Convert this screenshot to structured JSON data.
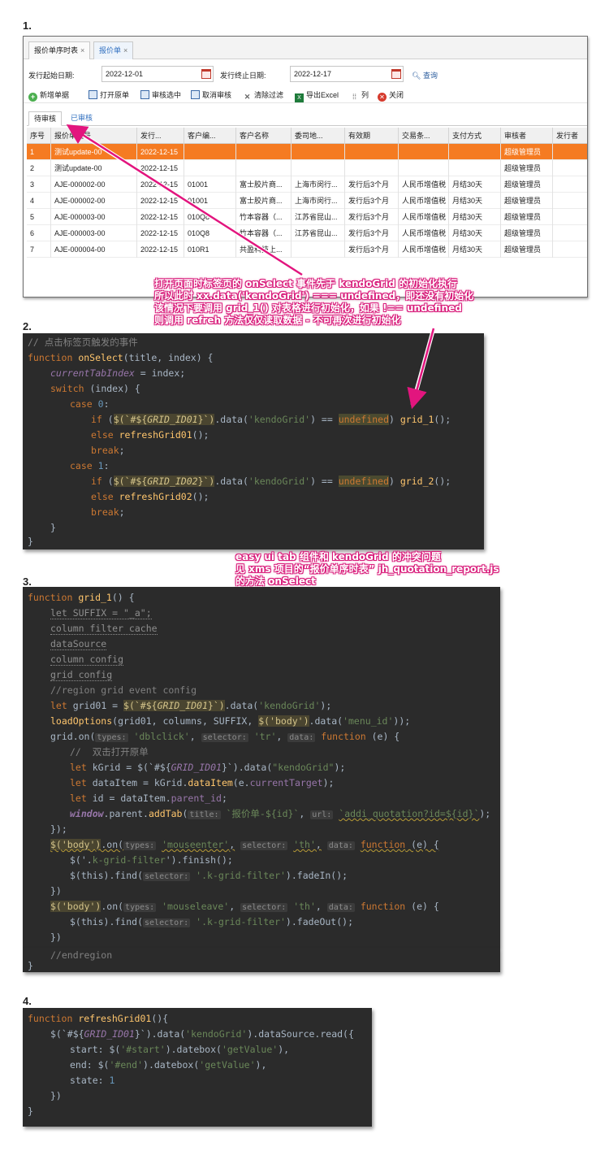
{
  "sections": {
    "s1": "1.",
    "s2": "2.",
    "s3": "3.",
    "s4": "4."
  },
  "app": {
    "tabs": [
      {
        "label": "报价单序时表",
        "close": "×"
      },
      {
        "label": "报价单",
        "close": "×"
      }
    ],
    "filter": {
      "start_label": "发行起始日期:",
      "start_value": "2022-12-01",
      "end_label": "发行终止日期:",
      "end_value": "2022-12-17",
      "query": "查询"
    },
    "toolbar": [
      "新增单据",
      "打开原单",
      "审核选中",
      "取消审核",
      "清除过滤",
      "导出Excel",
      "列",
      "关闭"
    ],
    "subtabs": [
      "待审核",
      "已审核"
    ],
    "grid": {
      "columns": [
        "序号",
        "报价单编号",
        "发行...",
        "客户编...",
        "客户名称",
        "委司地...",
        "有效期",
        "交易条...",
        "支付方式",
        "审核者",
        "发行者"
      ],
      "rows": [
        [
          "1",
          "测试update-00",
          "2022-12-15",
          "",
          "",
          "",
          "",
          "",
          "",
          "超级管理员",
          ""
        ],
        [
          "2",
          "测试update-00",
          "2022-12-15",
          "",
          "",
          "",
          "",
          "",
          "",
          "超级管理员",
          ""
        ],
        [
          "3",
          "AJE-000002-00",
          "2022-12-15",
          "01001",
          "富士胶片商...",
          "上海市闵行...",
          "发行后3个月",
          "人民币增值税",
          "月结30天",
          "超级管理员",
          ""
        ],
        [
          "4",
          "AJE-000002-00",
          "2022-12-15",
          "01001",
          "富士胶片商...",
          "上海市闵行...",
          "发行后3个月",
          "人民币增值税",
          "月结30天",
          "超级管理员",
          ""
        ],
        [
          "5",
          "AJE-000003-00",
          "2022-12-15",
          "010Q8",
          "竹本容器（...",
          "江苏省昆山...",
          "发行后3个月",
          "人民币增值税",
          "月结30天",
          "超级管理员",
          ""
        ],
        [
          "6",
          "AJE-000003-00",
          "2022-12-15",
          "010Q8",
          "竹本容器（...",
          "江苏省昆山...",
          "发行后3个月",
          "人民币增值税",
          "月结30天",
          "超级管理员",
          ""
        ],
        [
          "7",
          "AJE-000004-00",
          "2022-12-15",
          "010R1",
          "共盈科技上...",
          "",
          "发行后3个月",
          "人民币增值税",
          "月结30天",
          "超级管理员",
          ""
        ]
      ]
    }
  },
  "annotation1": [
    "打开页面时标签页的 onSelect 事件先于 kendoGrid 的初始化执行",
    "所以此时 xx.data('kendoGrid') === undefined，即还没有初始化",
    "该情况下要调用 grid_1() 对表格进行初始化，如果 !== undefined",
    "则调用 refreh 方法仅仅读取数据 - 不可再次进行初始化"
  ],
  "annotation2": [
    "easy ui tab 组件和 kendoGrid 的冲突问题",
    "见 xms 项目的“报价单序时表” jh_quotation_report.js",
    "的方法 onSelect"
  ],
  "code2": {
    "comment": "// 点击标签页触发的事件",
    "l1a": "function ",
    "l1b": "onSelect",
    "l1c": "(title, index) {",
    "l2a": "currentTabIndex",
    "l2b": " = index;",
    "l3a": "switch",
    "l3b": " (index) {",
    "case0a": "case ",
    "case0b": "0",
    "if": "if",
    "sel_open": "$(`#${",
    "grid1": "GRID_ID01",
    "grid2": "GRID_ID02",
    "sel_close": "}`)",
    "data": ".data(",
    "kg": "'kendoGrid'",
    "eq": ") == ",
    "undef": "undefined",
    "close_paren": ") ",
    "call1": "grid_1",
    "call2": "grid_2",
    "callend": "();",
    "else": "else ",
    "refresh1": "refreshGrid01",
    "refresh2": "refreshGrid02",
    "brk": "break",
    "semi": ";",
    "case1b": "1",
    "colon": ":",
    "rbrace": "}"
  },
  "code3": {
    "l1a": "function ",
    "l1b": "grid_1",
    "l1c": "() {",
    "l2": "let SUFFIX = \"_a\";",
    "l3": "column filter cache",
    "l4": "dataSource",
    "l5": "column config",
    "l6": "grid config",
    "l7": "//region grid event config",
    "l8a": "let ",
    "l8b": "grid01",
    "l8c": " = ",
    "l8d": "$(`#${",
    "l8e": "GRID_ID01",
    "l8f": "}`)",
    "l8g": ".data(",
    "l8h": "'kendoGrid'",
    "l8i": ");",
    "l9a": "loadOptions",
    "l9b": "(grid01, columns, SUFFIX, ",
    "l9c": "$(",
    "l9d": "'body'",
    "l9e": ")",
    "l9f": ".data(",
    "l9g": "'menu_id'",
    "l9h": "));",
    "l10a": "grid.on(",
    "h_types": "types:",
    "l10b": "'dblclick'",
    "h_selector": "selector:",
    "l10c": "'tr'",
    "h_data": "data:",
    "l10d": "function",
    "l10e": " (e) {",
    "l11": "//  双击打开原单",
    "l12a": "let ",
    "l12b": "kGrid",
    "l12c": " = $(`#${",
    "l12d": "GRID_ID01",
    "l12e": "}`).data(",
    "l12f": "\"kendoGrid\"",
    "l12g": ");",
    "l13a": "let ",
    "l13b": "dataItem",
    "l13c": " = kGrid.",
    "l13d": "dataItem",
    "l13e": "(e.",
    "l13f": "currentTarget",
    "l13g": ");",
    "l14a": "let ",
    "l14b": "id",
    "l14c": " = dataItem.",
    "l14d": "parent_id",
    "l14e": ";",
    "l15a": "window",
    "l15b": ".parent.",
    "l15c": "addTab",
    "l15d": "(",
    "h_title": "title:",
    "l15e": "`报价单-${id}`",
    "l15f": ",",
    "h_url": "url:",
    "l15g": "`addi_quotation?id=${id}`",
    "l15h": ");",
    "l16": "});",
    "l17a": "$(",
    "l17b": "'body'",
    "l17c": ")",
    "l17d": ".on(",
    "l17e": "'mouseenter'",
    "l17f": ",",
    "l17g": "'th'",
    "l17h": ",",
    "l17i": "function",
    "l17j": " (e) {",
    "l18a": "$('.",
    "l18b": "k-grid-filter",
    "l18c": "').finish();",
    "l19a": "$(this).find(",
    "l19b": "'.k-grid-filter'",
    "l19c": ").fadeIn();",
    "l20": "})",
    "l21e": "'mouseleave'",
    "l22c": ").fadeOut();",
    "l23": "})",
    "l24": "//endregion",
    "l25": "}"
  },
  "code4": {
    "l1a": "function ",
    "l1b": "refreshGrid01",
    "l1c": "(){",
    "l2a": "$(`#${",
    "l2b": "GRID_ID01",
    "l2c": "}`).data(",
    "l2d": "'kendoGrid'",
    "l2e": ").dataSource.read({",
    "l3a": "start: $(",
    "l3b": "'#start'",
    "l3c": ").datebox(",
    "l3d": "'getValue'",
    "l3e": "),",
    "l4a": "end: $(",
    "l4b": "'#end'",
    "l4c": ").datebox(",
    "l4d": "'getValue'",
    "l4e": "),",
    "l5a": "state: ",
    "l5b": "1",
    "l6": "})",
    "l7": "}"
  }
}
